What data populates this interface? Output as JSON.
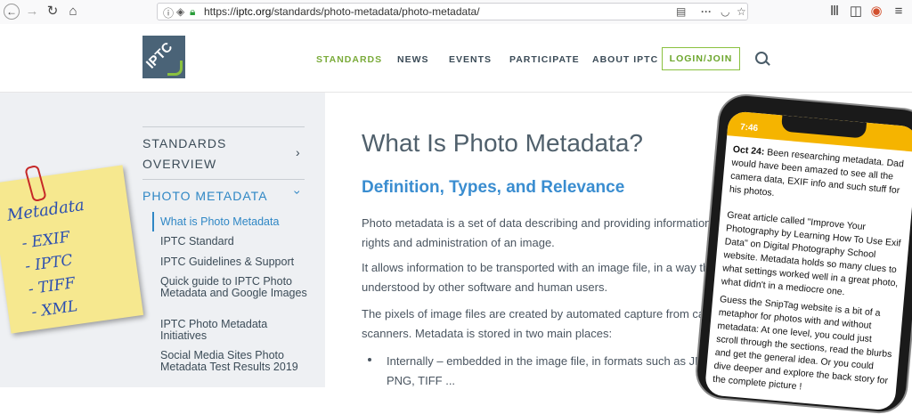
{
  "browser": {
    "url_scheme": "https://",
    "url_host": "iptc.org",
    "url_path": "/standards/photo-metadata/photo-metadata/"
  },
  "header": {
    "logo_text": "IPTC",
    "nav": [
      "STANDARDS",
      "NEWS",
      "EVENTS",
      "PARTICIPATE",
      "ABOUT IPTC"
    ],
    "login_label": "LOGIN/JOIN",
    "accent": "#8ac13f"
  },
  "sidebar": {
    "section1_line1": "STANDARDS",
    "section1_line2": "OVERVIEW",
    "section2": "PHOTO METADATA",
    "items": [
      "What is Photo Metadata",
      "IPTC Standard",
      "IPTC Guidelines & Support",
      "Quick guide to IPTC Photo Metadata and Google Images",
      "IPTC Photo Metadata Initiatives",
      "Social Media Sites Photo Metadata Test Results 2019"
    ]
  },
  "main": {
    "title": "What Is Photo Metadata?",
    "subtitle": "Definition, Types, and Relevance",
    "p1_line1": "Photo metadata is a set of data describing and providing information",
    "p1_line2": "rights and administration of an image.",
    "p2_line1": "It allows information to be transported with an image file, in a way tha",
    "p2_line2": "understood by other software and human users.",
    "p3_line1": "The pixels of image files are created by automated capture from came",
    "p3_line2": "scanners. Metadata is stored in two main places:",
    "bullet_line1": "Internally – embedded in the image file, in formats such as JPEG, D",
    "bullet_line2": "PNG, TIFF ..."
  },
  "sticky_note": {
    "lines": [
      "Metadata",
      "- EXIF",
      "- IPTC",
      "- TIFF",
      "- XML"
    ]
  },
  "phone": {
    "time": "7:46",
    "msg1_bold": "Oct 24:",
    "msg1": " Been researching metadata. Dad would have been amazed to see all the camera data, EXIF info and such stuff for his photos.",
    "msg2": "Great article called \"Improve Your Photography by Learning How To Use Exif Data\" on Digital Photography School website. Metadata holds so many clues to what settings worked well in a great photo, what didn't in a mediocre one.",
    "msg3": "Guess the SnipTag website is a bit of a metaphor for photos with and without metadata: At one level, you could just scroll through the sections, read the blurbs and get the general idea. Or you could dive deeper and explore the back story for the complete picture !"
  }
}
